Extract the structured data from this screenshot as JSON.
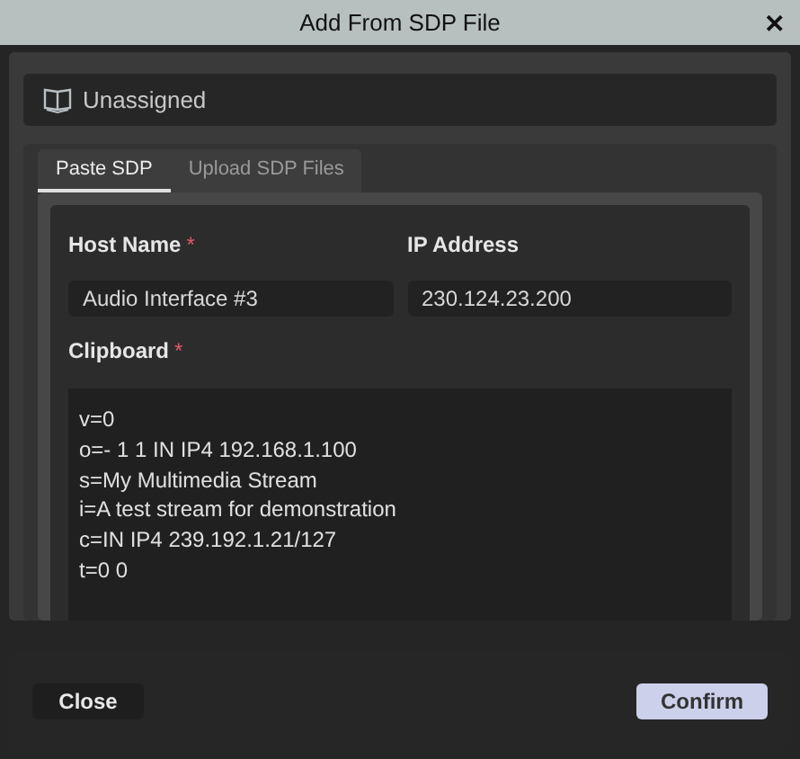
{
  "window": {
    "title": "Add From SDP File",
    "close": "✕"
  },
  "location": {
    "label": "Unassigned"
  },
  "tabs": [
    {
      "label": "Paste SDP",
      "selected": true
    },
    {
      "label": "Upload SDP Files",
      "selected": false
    }
  ],
  "fields": [
    {
      "label": "Host Name",
      "required_mark": "*",
      "value": "Audio Interface #3"
    },
    {
      "label": "IP Address",
      "value": "230.124.23.200"
    }
  ],
  "clipboard": {
    "label": "Clipboard",
    "required_mark": "*",
    "lines": [
      "v=0",
      "o=- 1 1 IN IP4 192.168.1.100",
      "s=My Multimedia Stream",
      "i=A test stream for demonstration",
      "c=IN IP4 239.192.1.21/127",
      "t=0 0"
    ]
  },
  "buttons": [
    {
      "label": "Close",
      "kind": "secondary"
    },
    {
      "label": "Confirm",
      "kind": "primary"
    }
  ]
}
